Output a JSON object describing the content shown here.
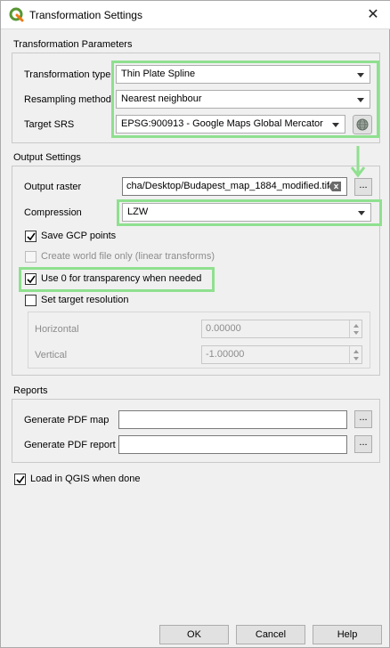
{
  "window": {
    "title": "Transformation Settings",
    "close_glyph": "✕"
  },
  "transformation_parameters": {
    "section_label": "Transformation Parameters",
    "transformation_type_label": "Transformation type",
    "transformation_type_value": "Thin Plate Spline",
    "resampling_method_label": "Resampling method",
    "resampling_method_value": "Nearest neighbour",
    "target_srs_label": "Target SRS",
    "target_srs_value": "EPSG:900913 - Google Maps Global Mercator"
  },
  "output_settings": {
    "section_label": "Output Settings",
    "output_raster_label": "Output raster",
    "output_raster_value": "cha/Desktop/Budapest_map_1884_modified.tif",
    "browse_label": "...",
    "compression_label": "Compression",
    "compression_value": "LZW",
    "save_gcp_label": "Save GCP points",
    "save_gcp_checked": true,
    "world_file_label": "Create world file only (linear transforms)",
    "world_file_checked": false,
    "use_zero_label": "Use 0 for transparency when needed",
    "use_zero_checked": true,
    "target_resolution_label": "Set target resolution",
    "target_resolution_checked": false,
    "horizontal_label": "Horizontal",
    "horizontal_value": "0.00000",
    "vertical_label": "Vertical",
    "vertical_value": "-1.00000"
  },
  "reports": {
    "section_label": "Reports",
    "pdf_map_label": "Generate PDF map",
    "pdf_map_value": "",
    "pdf_report_label": "Generate PDF report",
    "pdf_report_value": "",
    "browse_label": "..."
  },
  "load_in_qgis": {
    "label": "Load in QGIS when done",
    "checked": true
  },
  "buttons": {
    "ok": "OK",
    "cancel": "Cancel",
    "help": "Help"
  },
  "colors": {
    "highlight": "#8fe08f",
    "qgis_green": "#589632"
  },
  "icons": {
    "app": "qgis-logo-icon",
    "srs_selector": "globe-projection-icon",
    "clear": "clear-field-icon",
    "annotation_arrow": "down-arrow-icon"
  }
}
